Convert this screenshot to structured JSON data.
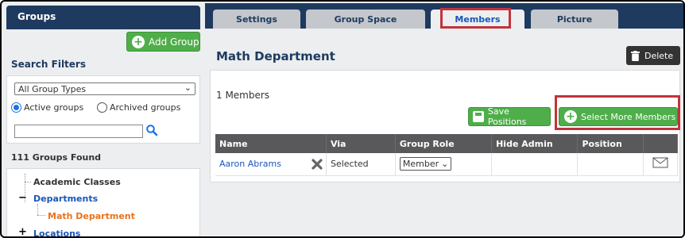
{
  "sidebar": {
    "header": "Groups",
    "add_group_label": "Add Group",
    "search_filters_label": "Search Filters",
    "group_type_select": "All Group Types",
    "active_label": "Active groups",
    "archived_label": "Archived groups",
    "search_value": "",
    "found_label": "111 Groups Found",
    "tree": {
      "academic": "Academic Classes",
      "departments": "Departments",
      "math": "Math Department",
      "locations": "Locations",
      "expand_minus": "−",
      "expand_plus": "+"
    }
  },
  "tabs": [
    {
      "label": "Settings"
    },
    {
      "label": "Group Space"
    },
    {
      "label": "Members"
    },
    {
      "label": "Picture"
    }
  ],
  "main": {
    "title": "Math Department",
    "delete_label": "Delete",
    "members_count": "1 Members",
    "save_positions_label": "Save Positions",
    "select_more_label": "Select More Members",
    "columns": [
      "Name",
      "Via",
      "Group Role",
      "Hide Admin",
      "Position",
      ""
    ],
    "rows": [
      {
        "name": "Aaron Abrams",
        "via": "Selected",
        "role": "Member"
      }
    ]
  },
  "colors": {
    "navy": "#1e3a5f",
    "green": "#4fae4a",
    "highlight_red": "#c0343b",
    "link_blue": "#1a56b8",
    "orange": "#e8731a"
  }
}
